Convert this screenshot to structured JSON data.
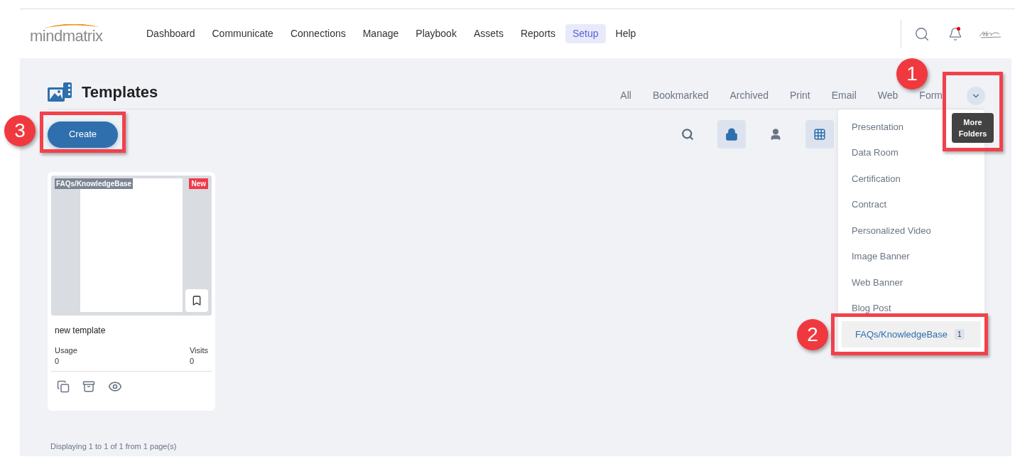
{
  "logo": {
    "text": "mindmatrix"
  },
  "nav": [
    {
      "label": "Dashboard",
      "selected": false
    },
    {
      "label": "Communicate",
      "selected": false
    },
    {
      "label": "Connections",
      "selected": false
    },
    {
      "label": "Manage",
      "selected": false
    },
    {
      "label": "Playbook",
      "selected": false
    },
    {
      "label": "Assets",
      "selected": false
    },
    {
      "label": "Reports",
      "selected": false
    },
    {
      "label": "Setup",
      "selected": true
    },
    {
      "label": "Help",
      "selected": false
    }
  ],
  "notifications": {
    "unread": true
  },
  "page": {
    "title": "Templates"
  },
  "folder_tabs": [
    {
      "label": "All",
      "selected": false
    },
    {
      "label": "Bookmarked",
      "selected": false
    },
    {
      "label": "Archived",
      "selected": false
    },
    {
      "label": "Print",
      "selected": false
    },
    {
      "label": "Email",
      "selected": false
    },
    {
      "label": "Web",
      "selected": false
    },
    {
      "label": "Form",
      "selected": false
    }
  ],
  "more_folders_tooltip": "More Folders",
  "create_button": "Create",
  "view_tools": [
    {
      "kind": "search",
      "selected": false
    },
    {
      "kind": "lock",
      "selected": true
    },
    {
      "kind": "person",
      "selected": false
    },
    {
      "kind": "grid",
      "selected": true
    }
  ],
  "folder_menu": [
    {
      "label": "Presentation",
      "selected": false
    },
    {
      "label": "Data Room",
      "selected": false
    },
    {
      "label": "Certification",
      "selected": false
    },
    {
      "label": "Contract",
      "selected": false
    },
    {
      "label": "Personalized Video",
      "selected": false
    },
    {
      "label": "Image Banner",
      "selected": false
    },
    {
      "label": "Web Banner",
      "selected": false
    },
    {
      "label": "Blog Post",
      "selected": false
    },
    {
      "label": "FAQs/KnowledgeBase",
      "count": "1",
      "selected": true
    }
  ],
  "cards": [
    {
      "folder_tag": "FAQs/KnowledgeBase",
      "badge": "New",
      "title": "new template",
      "usage_label": "Usage",
      "usage": "0",
      "visits_label": "Visits",
      "visits": "0",
      "bookmarked": false
    }
  ],
  "pagination": "Displaying 1 to 1 of 1 from 1 page(s)",
  "callouts": [
    {
      "label": "1"
    },
    {
      "label": "2"
    },
    {
      "label": "3"
    }
  ]
}
